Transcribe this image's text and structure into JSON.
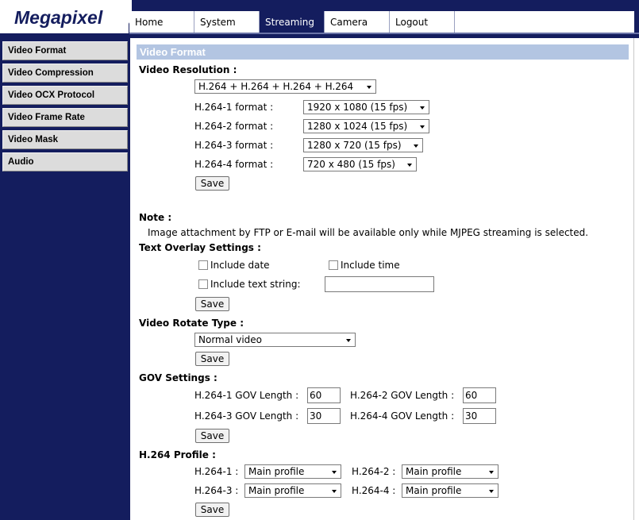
{
  "header": {
    "logo": "Megapixel",
    "tabs": [
      "Home",
      "System",
      "Streaming",
      "Camera",
      "Logout"
    ],
    "active_tab": "Streaming"
  },
  "sidebar": {
    "items": [
      "Video Format",
      "Video Compression",
      "Video OCX Protocol",
      "Video Frame Rate",
      "Video Mask",
      "Audio"
    ]
  },
  "page_title": "Video Format",
  "video_resolution": {
    "title": "Video Resolution :",
    "mode_value": "H.264 + H.264 + H.264 + H.264",
    "formats": [
      {
        "label": "H.264-1 format :",
        "value": "1920 x 1080 (15 fps)"
      },
      {
        "label": "H.264-2 format :",
        "value": "1280 x 1024 (15 fps)"
      },
      {
        "label": "H.264-3 format :",
        "value": "1280 x 720 (15 fps)"
      },
      {
        "label": "H.264-4 format :",
        "value": "720 x 480 (15 fps)"
      }
    ],
    "save": "Save"
  },
  "note": {
    "title": "Note :",
    "text": "Image attachment by FTP or E-mail will be available only while MJPEG streaming is selected."
  },
  "text_overlay": {
    "title": "Text Overlay Settings :",
    "include_date": "Include date",
    "include_time": "Include time",
    "include_text": "Include text string:",
    "text_value": "",
    "save": "Save"
  },
  "rotate": {
    "title": "Video Rotate Type :",
    "value": "Normal video",
    "save": "Save"
  },
  "gov": {
    "title": "GOV Settings :",
    "items": [
      {
        "label": "H.264-1 GOV Length :",
        "value": "60"
      },
      {
        "label": "H.264-2 GOV Length :",
        "value": "60"
      },
      {
        "label": "H.264-3 GOV Length :",
        "value": "30"
      },
      {
        "label": "H.264-4 GOV Length :",
        "value": "30"
      }
    ],
    "save": "Save"
  },
  "profile": {
    "title": "H.264 Profile :",
    "items": [
      {
        "label": "H.264-1 :",
        "value": "Main profile"
      },
      {
        "label": "H.264-2 :",
        "value": "Main profile"
      },
      {
        "label": "H.264-3 :",
        "value": "Main profile"
      },
      {
        "label": "H.264-4 :",
        "value": "Main profile"
      }
    ],
    "save": "Save"
  }
}
